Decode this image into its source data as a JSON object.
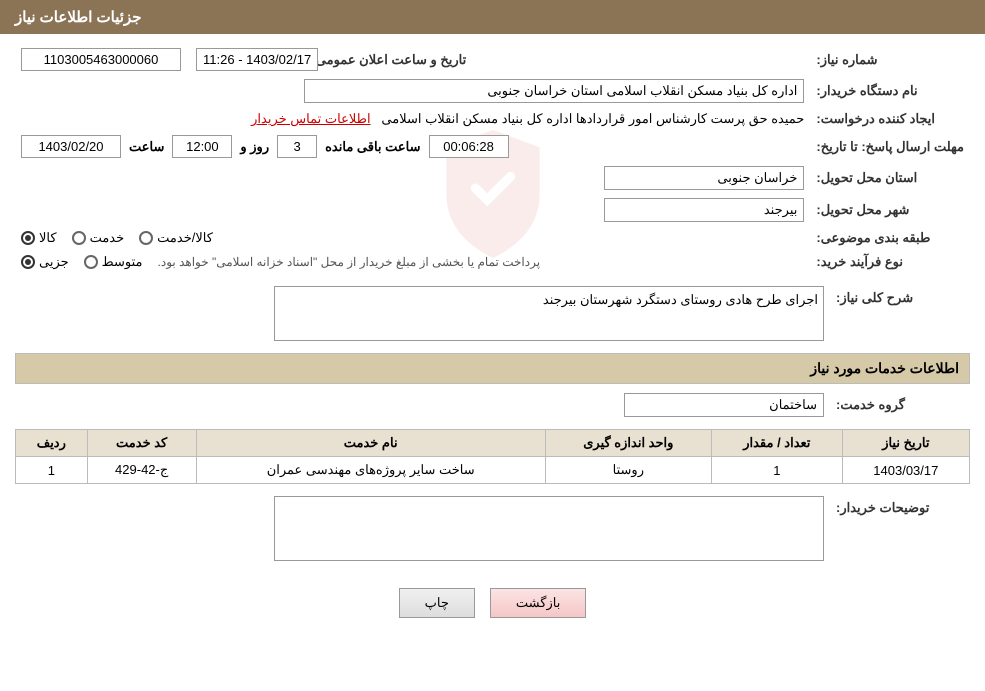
{
  "header": {
    "title": "جزئیات اطلاعات نیاز"
  },
  "fields": {
    "need_number_label": "شماره نیاز:",
    "need_number_value": "1103005463000060",
    "announce_date_label": "تاریخ و ساعت اعلان عمومی:",
    "announce_date_value": "1403/02/17 - 11:26",
    "buyer_org_label": "نام دستگاه خریدار:",
    "buyer_org_value": "اداره کل بنیاد مسکن انقلاب اسلامی استان خراسان جنوبی",
    "requester_label": "ایجاد کننده درخواست:",
    "requester_value": "حمیده حق پرست کارشناس امور قراردادها اداره کل بنیاد مسکن انقلاب اسلامی",
    "contact_link": "اطلاعات تماس خریدار",
    "deadline_label": "مهلت ارسال پاسخ: تا تاریخ:",
    "deadline_date": "1403/02/20",
    "deadline_time_label": "ساعت",
    "deadline_time": "12:00",
    "deadline_days_label": "روز و",
    "deadline_days": "3",
    "deadline_remaining_label": "ساعت باقی مانده",
    "deadline_remaining": "00:06:28",
    "province_label": "استان محل تحویل:",
    "province_value": "خراسان جنوبی",
    "city_label": "شهر محل تحویل:",
    "city_value": "بیرجند",
    "category_label": "طبقه بندی موضوعی:",
    "category_kala": "کالا",
    "category_khedmat": "خدمت",
    "category_kala_khedmat": "کالا/خدمت",
    "purchase_type_label": "نوع فرآیند خرید:",
    "purchase_jozyi": "جزیی",
    "purchase_motavaset": "متوسط",
    "purchase_note": "پرداخت تمام یا بخشی از مبلغ خریدار از محل \"اسناد خزانه اسلامی\" خواهد بود.",
    "description_label": "شرح کلی نیاز:",
    "description_value": "اجرای طرح هادی روستای دستگرد شهرستان بیرجند",
    "services_header": "اطلاعات خدمات مورد نیاز",
    "service_group_label": "گروه خدمت:",
    "service_group_value": "ساختمان",
    "table_headers": {
      "row_num": "ردیف",
      "service_code": "کد خدمت",
      "service_name": "نام خدمت",
      "unit": "واحد اندازه گیری",
      "quantity": "تعداد / مقدار",
      "date": "تاریخ نیاز"
    },
    "table_rows": [
      {
        "row_num": "1",
        "service_code": "ج-42-429",
        "service_name": "ساخت سایر پروژه‌های مهندسی عمران",
        "unit": "روستا",
        "quantity": "1",
        "date": "1403/03/17"
      }
    ],
    "buyer_notes_label": "توضیحات خریدار:",
    "buyer_notes_value": ""
  },
  "buttons": {
    "print": "چاپ",
    "back": "بازگشت"
  }
}
